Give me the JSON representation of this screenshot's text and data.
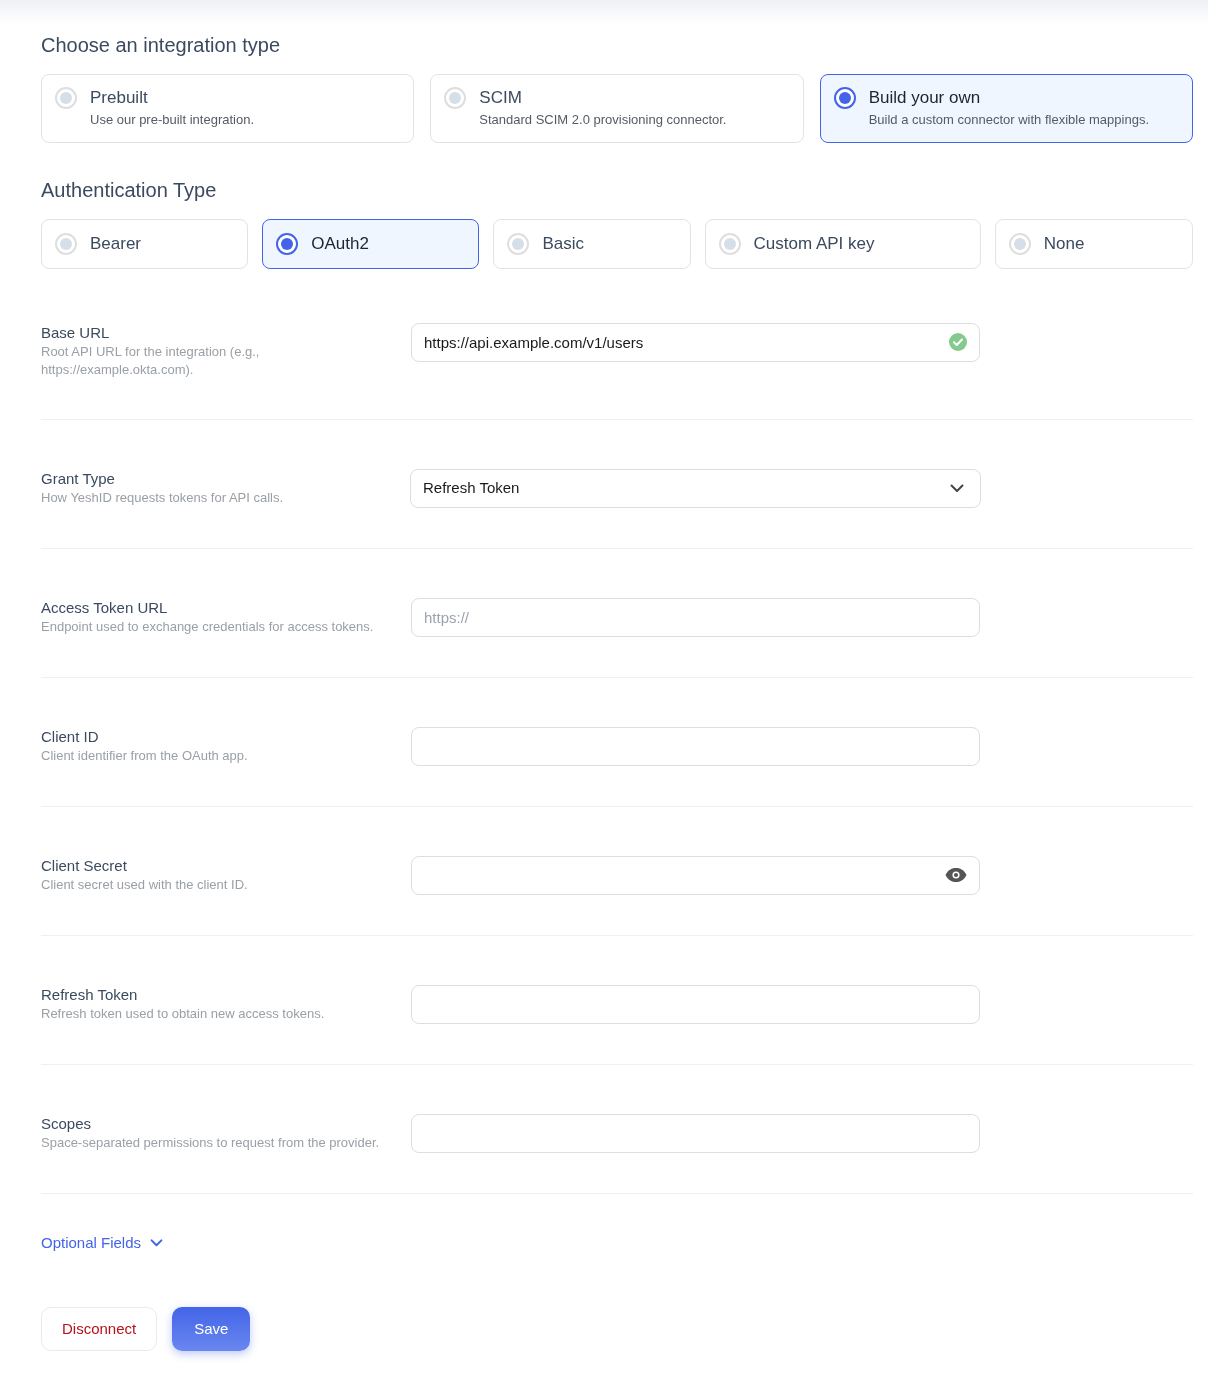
{
  "integration_type": {
    "heading": "Choose an integration type",
    "options": [
      {
        "title": "Prebuilt",
        "description": "Use our pre-built integration.",
        "selected": false
      },
      {
        "title": "SCIM",
        "description": "Standard SCIM 2.0 provisioning connector.",
        "selected": false
      },
      {
        "title": "Build your own",
        "description": "Build a custom connector with flexible mappings.",
        "selected": true
      }
    ]
  },
  "authentication_type": {
    "heading": "Authentication Type",
    "options": [
      {
        "label": "Bearer",
        "selected": false
      },
      {
        "label": "OAuth2",
        "selected": true
      },
      {
        "label": "Basic",
        "selected": false
      },
      {
        "label": "Custom API key",
        "selected": false
      },
      {
        "label": "None",
        "selected": false
      }
    ]
  },
  "fields": [
    {
      "kind": "text",
      "label": "Base URL",
      "description": "Root API URL for the integration (e.g., https://example.okta.com).",
      "value": "https://api.example.com/v1/users",
      "valid": true
    },
    {
      "kind": "select",
      "label": "Grant Type",
      "description": "How YeshID requests tokens for API calls.",
      "value": "Refresh Token"
    },
    {
      "kind": "text",
      "label": "Access Token URL",
      "description": "Endpoint used to exchange credentials for access tokens.",
      "placeholder": "https://"
    },
    {
      "kind": "text",
      "label": "Client ID",
      "description": "Client identifier from the OAuth app."
    },
    {
      "kind": "secret",
      "label": "Client Secret",
      "description": "Client secret used with the client ID."
    },
    {
      "kind": "text",
      "label": "Refresh Token",
      "description": "Refresh token used to obtain new access tokens."
    },
    {
      "kind": "text",
      "label": "Scopes",
      "description": "Space-separated permissions to request from the provider."
    }
  ],
  "optional_fields": {
    "label": "Optional Fields",
    "expanded": false
  },
  "buttons": [
    {
      "kind": "danger",
      "label": "Disconnect"
    },
    {
      "kind": "primary",
      "label": "Save"
    }
  ]
}
